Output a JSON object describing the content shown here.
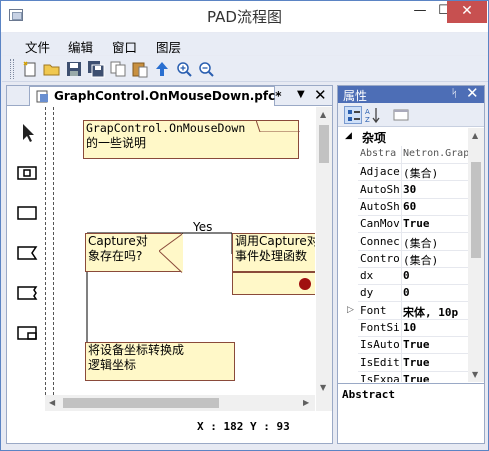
{
  "window": {
    "title": "PAD流程图"
  },
  "menu": [
    "文件",
    "编辑",
    "窗口",
    "图层"
  ],
  "toolbar": [
    "new-icon",
    "open-icon",
    "save-icon",
    "save-all-icon",
    "copy-icon",
    "paste-icon",
    "up-arrow-icon",
    "zoom-in-icon",
    "zoom-out-icon"
  ],
  "document": {
    "tab_label": "GraphControl.OnMouseDown.pfc*",
    "tab_close": "✕",
    "tab_dropdown": "▼"
  },
  "palette": [
    "pointer-tool-icon",
    "process-shape-icon",
    "rectangle-shape-icon",
    "flag-shape-icon",
    "banner-shape-icon",
    "document-shape-icon"
  ],
  "canvas": {
    "comment_line1": "GrapControl.OnMouseDown",
    "comment_line2": "的一些说明",
    "yes_label": "Yes",
    "decision_line1": "Capture对",
    "decision_line2": "象存在吗?",
    "action_line1": "调用Capture对",
    "action_line2": "事件处理函数",
    "convert_line1": "将设备坐标转换成",
    "convert_line2": "逻辑坐标"
  },
  "status": {
    "coordinates": "X : 182 Y : 93"
  },
  "properties": {
    "title": "属性",
    "pin": "ᛋ",
    "close": "✕",
    "category": "杂项",
    "rows": [
      {
        "name": "Abstra",
        "value": "Netron.Grap",
        "plain": true
      },
      {
        "name": "Adjace",
        "value": "(集合)",
        "plain": true
      },
      {
        "name": "AutoSh",
        "value": "30"
      },
      {
        "name": "AutoSh",
        "value": "60"
      },
      {
        "name": "CanMov",
        "value": "True"
      },
      {
        "name": "Connec",
        "value": "(集合)",
        "plain": true
      },
      {
        "name": "Contro",
        "value": "(集合)",
        "plain": true
      },
      {
        "name": "dx",
        "value": "0"
      },
      {
        "name": "dy",
        "value": "0"
      },
      {
        "name": "Font",
        "value": "宋体, 10p"
      },
      {
        "name": "FontSi",
        "value": "10"
      },
      {
        "name": "IsAuto",
        "value": "True"
      },
      {
        "name": "IsEdit",
        "value": "True"
      },
      {
        "name": "IsExpa",
        "value": "True"
      }
    ],
    "description": "Abstract"
  },
  "colors": {
    "shape_fill": "#fff8c8",
    "shape_border": "#8a4a3a",
    "panel_header": "#4d6eb6",
    "close_red": "#c75050",
    "dot": "#a01010"
  }
}
